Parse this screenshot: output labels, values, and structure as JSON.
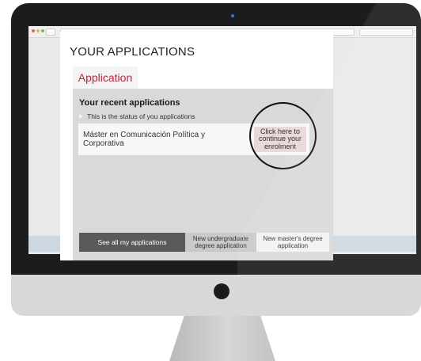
{
  "page": {
    "title": "YOUR APPLICATIONS",
    "tab_label": "Application"
  },
  "panel": {
    "heading": "Your recent applications",
    "status_note": "This is the status of you applications",
    "application": {
      "name": "Máster en Comunicación Política y Corporativa",
      "continue_label": "Click here to continue your enrolment"
    }
  },
  "buttons": {
    "see_all": "See all my applications",
    "new_undergraduate": "New undergraduate degree application",
    "new_masters": "New master's degree application"
  },
  "colors": {
    "accent": "#b5273a",
    "panel_bg": "#d9d9d9",
    "primary_button": "#5a5a5a",
    "monitor_bezel": "#1c1c1e"
  },
  "icons": [
    "status-arrow-icon",
    "camera-icon",
    "home-button-icon"
  ]
}
